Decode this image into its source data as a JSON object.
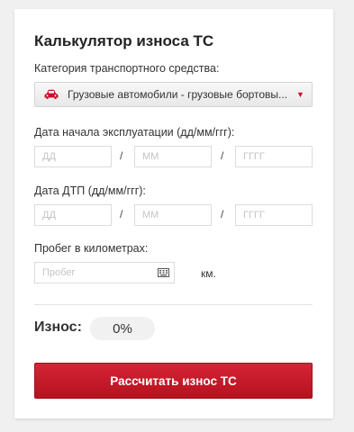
{
  "calculator": {
    "title": "Калькулятор износа ТС",
    "vehicle_category": {
      "label": "Категория транспортного средства:",
      "selected_value": "Грузовые автомобили - грузовые бортовы...",
      "icon": "car-icon"
    },
    "start_date": {
      "label": "Дата начала эксплуатации (дд/мм/ггг):",
      "day_placeholder": "ДД",
      "month_placeholder": "ММ",
      "year_placeholder": "ГГГГ",
      "separator": "/"
    },
    "accident_date": {
      "label": "Дата ДТП (дд/мм/ггг):",
      "day_placeholder": "ДД",
      "month_placeholder": "ММ",
      "year_placeholder": "ГГГГ",
      "separator": "/"
    },
    "mileage": {
      "label": "Пробег в километрах:",
      "placeholder": "Пробег",
      "unit": "км.",
      "icon": "keypad-icon"
    },
    "result": {
      "label": "Износ:",
      "value": "0%"
    },
    "submit_button": "Рассчитать износ ТС",
    "colors": {
      "accent": "#c8102e",
      "button_top": "#d62436",
      "button_bottom": "#b4121f"
    }
  }
}
